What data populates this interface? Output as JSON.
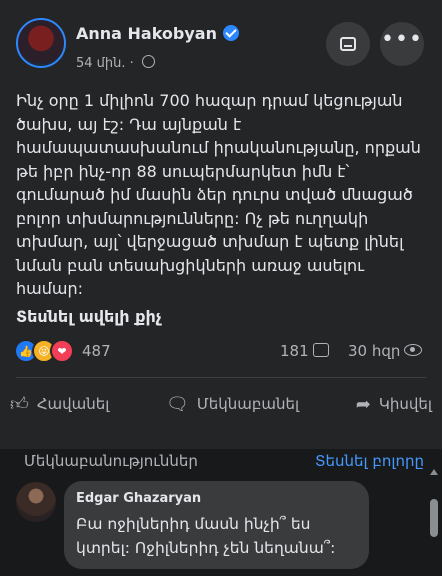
{
  "post": {
    "author": "Anna Hakobyan",
    "time": "54 մին.",
    "text": "Ինչ օրը 1 միլիոն 700 հազար դրամ կեցության ծախս, այ էշ: Դա այնքան է համապատասխանում իրականությանը, որքան թե իբր ինչ-որ 88 սուպերմարկետ իմն է՝ գումարած իմ մասին ձեր դուրս տված մնացած բոլոր տխմարությունները: Ոչ թե ուղղակի տխմար, այլ՝ վերջացած տխմար է պետք լինել նման բան տեսախցիկների առաջ ասելու համար:",
    "see_more": "Տեսնել ավելի քիչ",
    "reaction_count": "487",
    "comment_count": "181",
    "view_count": "30 հզր"
  },
  "actions": {
    "like": "Հավանել",
    "comment": "Մեկնաբանել",
    "share": "Կիսվել"
  },
  "comments": {
    "header": "Մեկնաբանություններ",
    "see_all": "Տեսնել բոլորը",
    "items": [
      {
        "author": "Edgar Ghazaryan",
        "text": "Բա ոջիլներիդ մասն ինչի՞ ես կտրել: Ոջիլներիդ չեն նեղանա՞:"
      }
    ]
  },
  "colors": {
    "background": "#18191a",
    "card": "#242526",
    "link_blue": "#4599ff",
    "like_blue": "#2078f4",
    "love_red": "#f33e58",
    "haha_yellow": "#f7b125"
  },
  "icons": [
    "verified-icon",
    "globe-icon",
    "save-icon",
    "more-icon",
    "like-reaction-icon",
    "haha-reaction-icon",
    "love-reaction-icon",
    "comment-icon",
    "eye-icon",
    "thumbs-up-icon",
    "share-icon"
  ]
}
